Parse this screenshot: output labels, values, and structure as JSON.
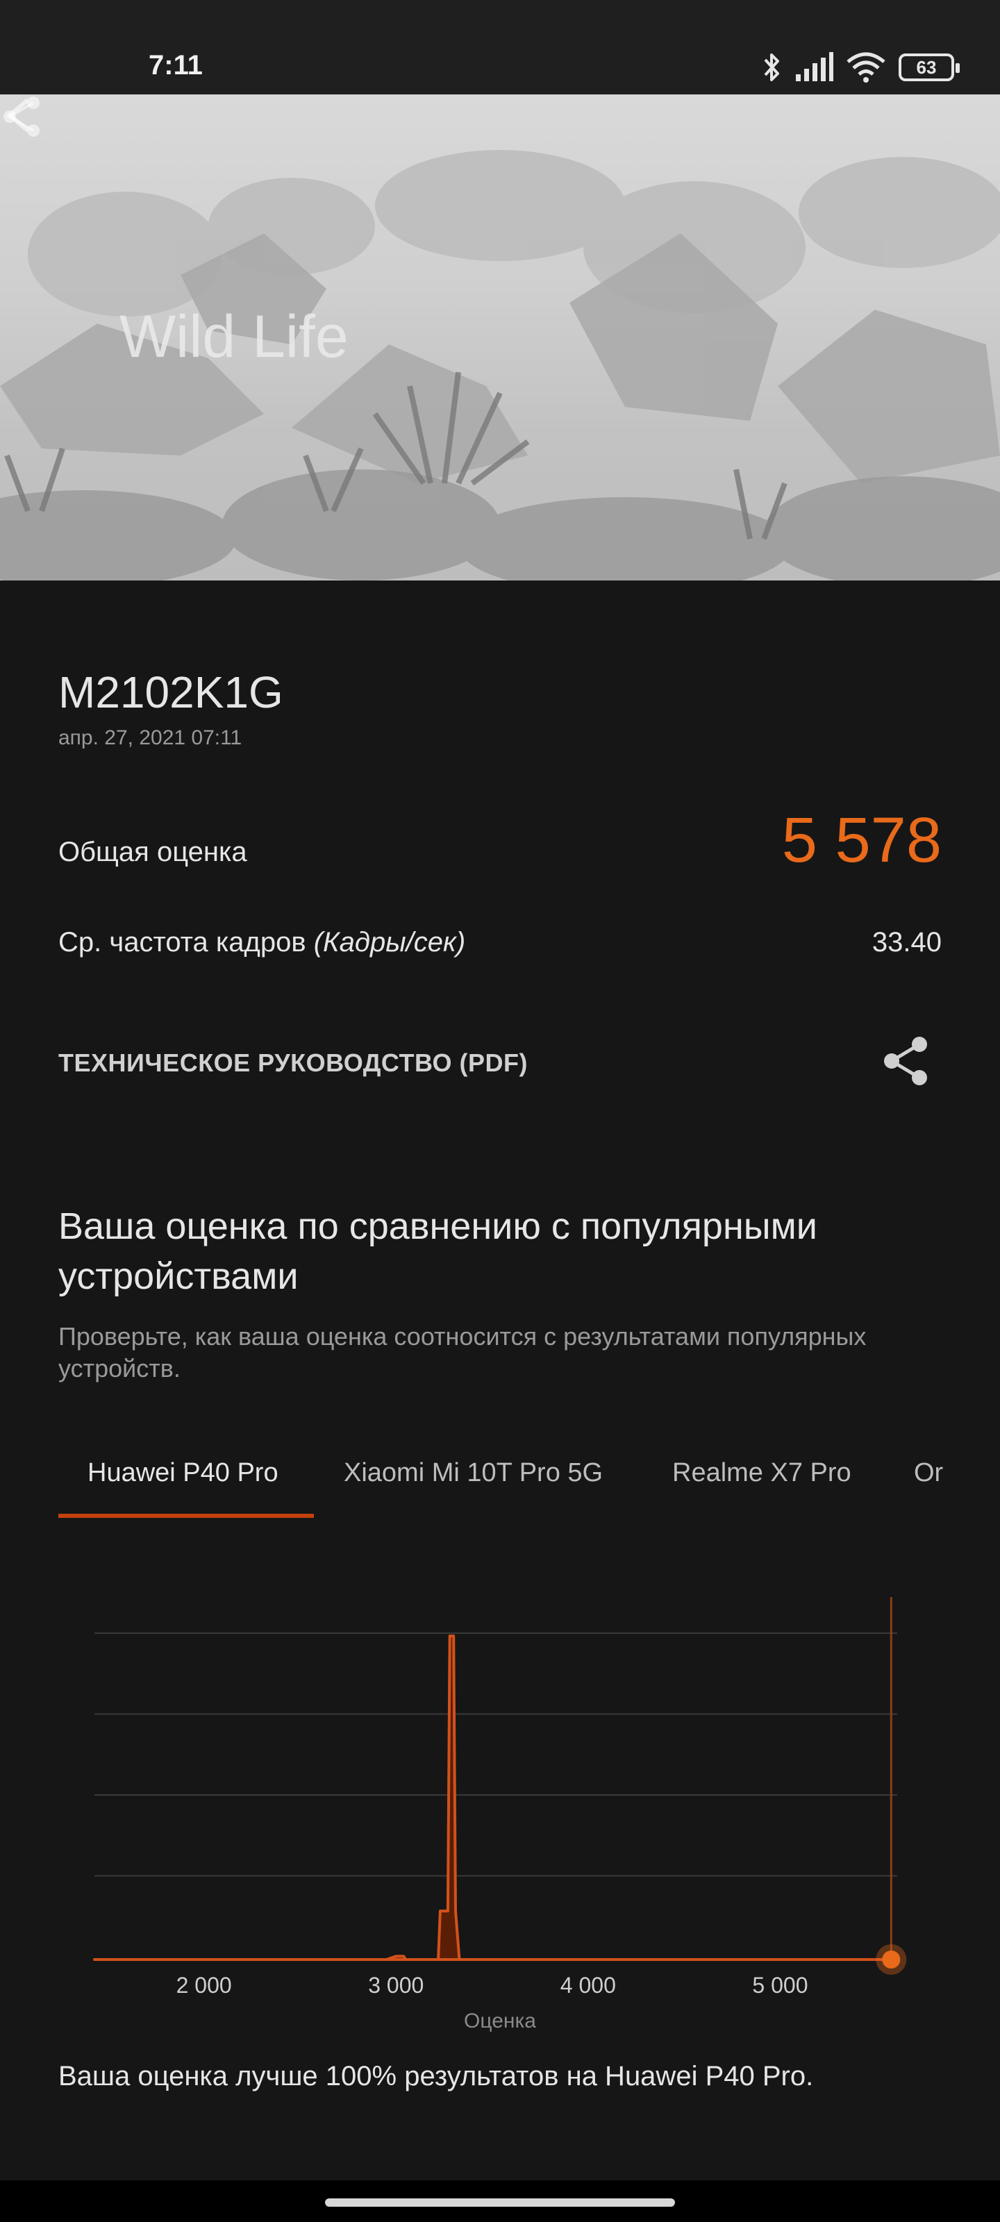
{
  "status_bar": {
    "time": "7:11",
    "battery": "63",
    "icons": [
      "bluetooth-icon",
      "signal-icon",
      "wifi-icon",
      "battery-icon"
    ]
  },
  "hero": {
    "title": "Wild Life",
    "icons": [
      "back-arrow-icon",
      "share-icon"
    ]
  },
  "result": {
    "device": "M2102K1G",
    "date": "апр. 27, 2021 07:11",
    "overall_label": "Общая оценка",
    "overall_value": "5 578",
    "fps_label": "Ср. частота кадров ",
    "fps_unit": "(Кадры/сек)",
    "fps_value": "33.40"
  },
  "pdf": {
    "label": "ТЕХНИЧЕСКОЕ РУКОВОДСТВО (PDF)",
    "icon": "share-icon"
  },
  "comparison": {
    "title": "Ваша оценка по сравнению с популярными устройствами",
    "subtitle": "Проверьте, как ваша оценка соотносится с результатами популярных устройств.",
    "tabs": [
      "Huawei P40 Pro",
      "Xiaomi Mi 10T Pro 5G",
      "Realme X7 Pro",
      "Or"
    ],
    "active_tab": "Huawei P40 Pro",
    "summary": "Ваша оценка лучше 100% результатов на Huawei P40 Pro."
  },
  "chart_data": {
    "type": "area",
    "xlabel": "Оценка",
    "ylabel": "",
    "xlim": [
      1430,
      5660
    ],
    "ylim": [
      0,
      1
    ],
    "grid": true,
    "x_ticks": [
      2000,
      3000,
      4000,
      5000
    ],
    "x_tick_labels": [
      "2 000",
      "3 000",
      "4 000",
      "5 000"
    ],
    "series": [
      {
        "x": [
          1430,
          2950,
          3000,
          3040,
          3050,
          3220,
          3230,
          3270,
          3280,
          3300,
          3310,
          3330
        ],
        "y": [
          0,
          0,
          0.01,
          0.01,
          0,
          0,
          0.15,
          0.15,
          1.0,
          1.0,
          0.15,
          0
        ]
      }
    ],
    "your_score": 5578,
    "colors": {
      "distribution_fill": "#5a1e07",
      "distribution_stroke": "#d2521a",
      "your_score_marker": "#e86a1a"
    }
  },
  "colors": {
    "accent": "#e86a1a",
    "tab_indicator": "#c2410c",
    "background": "#161616"
  }
}
